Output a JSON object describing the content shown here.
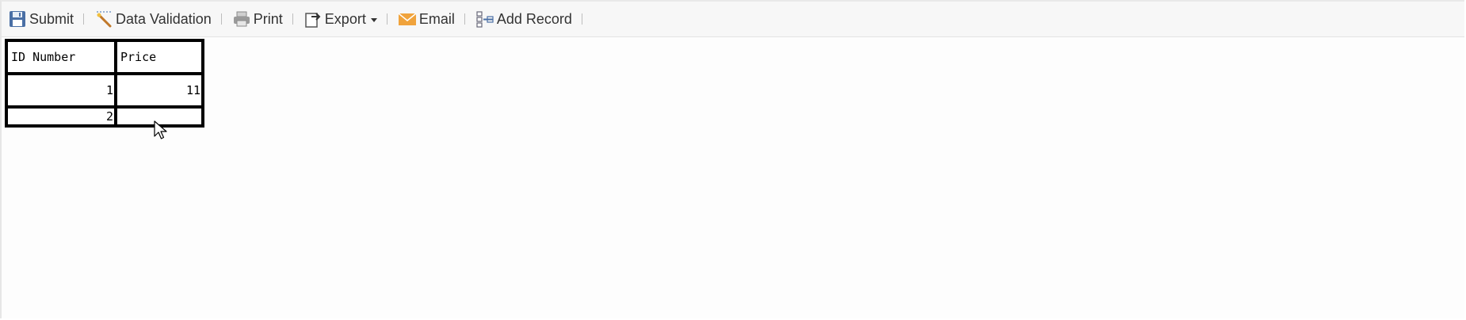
{
  "toolbar": {
    "items": [
      {
        "label": "Submit",
        "icon": "save-icon"
      },
      {
        "label": "Data Validation",
        "icon": "validation-wand-icon"
      },
      {
        "label": "Print",
        "icon": "printer-icon"
      },
      {
        "label": "Export",
        "icon": "export-icon",
        "has_dropdown": true
      },
      {
        "label": "Email",
        "icon": "email-envelope-icon"
      },
      {
        "label": "Add Record",
        "icon": "add-record-icon"
      }
    ]
  },
  "sheet": {
    "headers": [
      "ID Number",
      "Price"
    ],
    "rows": [
      [
        "1",
        "11"
      ],
      [
        "2",
        ""
      ]
    ]
  },
  "colors": {
    "toolbar_bg": "#f7f7f7",
    "grid_border": "#000000",
    "email_icon": "#f0a33c",
    "save_icon": "#4a6fa5"
  }
}
